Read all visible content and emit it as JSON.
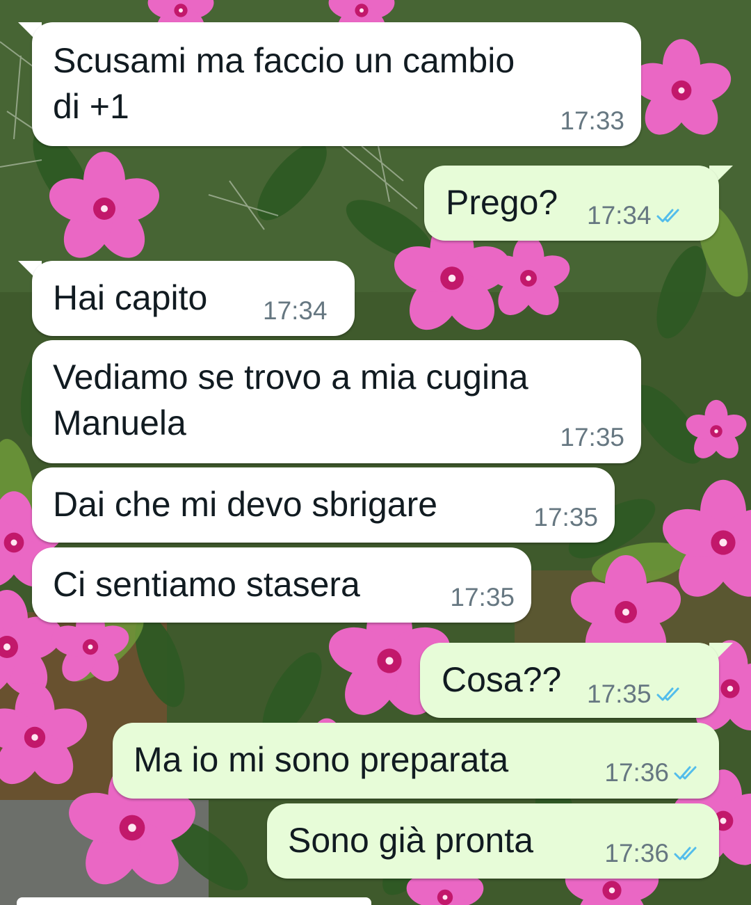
{
  "theme": {
    "incoming_bubble": "#ffffff",
    "outgoing_bubble": "#e7fcd8",
    "text_color": "#111b21",
    "time_color": "#667781",
    "read_tick_color": "#53bdeb"
  },
  "messages": [
    {
      "id": "m1",
      "direction": "incoming",
      "text": "Scusami ma faccio un cambio\ndi +1",
      "time": "17:33"
    },
    {
      "id": "m2",
      "direction": "outgoing",
      "text": "Prego?",
      "time": "17:34",
      "status": "read"
    },
    {
      "id": "m3",
      "direction": "incoming",
      "text": "Hai capito",
      "time": "17:34"
    },
    {
      "id": "m4",
      "direction": "incoming",
      "text": "Vediamo se trovo a mia cugina\nManuela",
      "time": "17:35"
    },
    {
      "id": "m5",
      "direction": "incoming",
      "text": "Dai che mi devo sbrigare",
      "time": "17:35"
    },
    {
      "id": "m6",
      "direction": "incoming",
      "text": "Ci sentiamo stasera",
      "time": "17:35"
    },
    {
      "id": "m7",
      "direction": "outgoing",
      "text": "Cosa??",
      "time": "17:35",
      "status": "read"
    },
    {
      "id": "m8",
      "direction": "outgoing",
      "text": "Ma io mi sono preparata",
      "time": "17:36",
      "status": "read"
    },
    {
      "id": "m9",
      "direction": "outgoing",
      "text": "Sono già pronta",
      "time": "17:36",
      "status": "read"
    }
  ]
}
